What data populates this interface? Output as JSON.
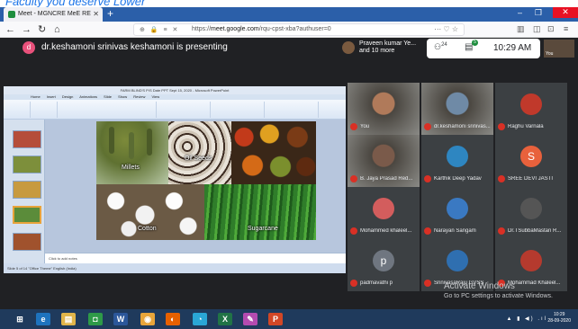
{
  "caption": "Faculty you deserve Lower",
  "browser": {
    "tab_title": "Meet - MGNCRE MeE RE",
    "url_prefix": "https://",
    "url_domain": "meet.google.com",
    "url_path": "/rqu-cpst-xba?authuser=0",
    "url_more": "··· ♡ ☆",
    "new_tab": "+",
    "window_controls": [
      "–",
      "❐",
      "✕"
    ]
  },
  "meet": {
    "presenter_initial": "d",
    "presenting_text": "dr.keshamoni srinivas keshamoni is presenting",
    "participants_pill": "Praveen kumar Ye... and 10 more",
    "people_count": "24",
    "chat_badge": "5",
    "time": "10:29 AM",
    "self_label": "You"
  },
  "powerpoint": {
    "title": "FARM BLIND'S P/S Date PPT Sept 15, 2020 - Microsoft PowerPoint",
    "tabs": "Home Insert Design Animations Slide Show Review View",
    "notes": "Click to add notes",
    "status": "Slide 5 of 14   \"Office Theme\"   English (India)",
    "slide_labels": {
      "millets": "Millets",
      "oilseeds": "Oil Seeds",
      "cotton": "Cotton",
      "sugarcane": "Sugarcane"
    }
  },
  "participants": [
    {
      "name": "You",
      "type": "camera",
      "color": "#b07a5a"
    },
    {
      "name": "dr.keshamoni srinivas...",
      "type": "camera",
      "color": "#6f8aa6"
    },
    {
      "name": "Raghu Varnala",
      "type": "avatar",
      "color": "#c0392b",
      "initial": ""
    },
    {
      "name": "B. Jaya Prasad Red...",
      "type": "camera",
      "color": "#7a5a4a"
    },
    {
      "name": "Karthik Deep Yadav",
      "type": "avatar",
      "color": "#2e86c1",
      "initial": ""
    },
    {
      "name": "SREE DEVI JASTI",
      "type": "avatar",
      "color": "#e8613c",
      "initial": "S"
    },
    {
      "name": "Mohammed khaleel...",
      "type": "avatar",
      "color": "#d35d5d",
      "initial": ""
    },
    {
      "name": "Narayan Sangam",
      "type": "avatar",
      "color": "#3a79c2",
      "initial": ""
    },
    {
      "name": "Dr.TSubbaMastan R...",
      "type": "avatar",
      "color": "#555",
      "initial": ""
    },
    {
      "name": "padmavathi p",
      "type": "avatar",
      "color": "#6f7680",
      "initial": "p"
    },
    {
      "name": "SrinivasaRaju GVSS",
      "type": "avatar",
      "color": "#2f6fb0",
      "initial": ""
    },
    {
      "name": "Mohammad Khaleel...",
      "type": "avatar",
      "color": "#b53a2e",
      "initial": ""
    }
  ],
  "watermark": {
    "line1": "Activate Windows",
    "line2": "Go to PC settings to activate Windows."
  },
  "taskbar": {
    "items": [
      {
        "name": "start",
        "glyph": "⊞",
        "color": "#1f3a5c"
      },
      {
        "name": "ie",
        "glyph": "e",
        "color": "#1e73be"
      },
      {
        "name": "explorer",
        "glyph": "▤",
        "color": "#e0b54a"
      },
      {
        "name": "green-app",
        "glyph": "◘",
        "color": "#2e9a48"
      },
      {
        "name": "word",
        "glyph": "W",
        "color": "#2b579a"
      },
      {
        "name": "chrome",
        "glyph": "◉",
        "color": "#e8a53a"
      },
      {
        "name": "firefox",
        "glyph": "◐",
        "color": "#e66000"
      },
      {
        "name": "edge",
        "glyph": "◔",
        "color": "#2aa6d6"
      },
      {
        "name": "excel",
        "glyph": "X",
        "color": "#217346"
      },
      {
        "name": "paint",
        "glyph": "✎",
        "color": "#b34bb0"
      },
      {
        "name": "powerpoint",
        "glyph": "P",
        "color": "#d24726"
      }
    ],
    "clock_time": "10:29",
    "clock_date": "28-09-2020",
    "tray": "▲ ▮ ◀) .ıl"
  }
}
